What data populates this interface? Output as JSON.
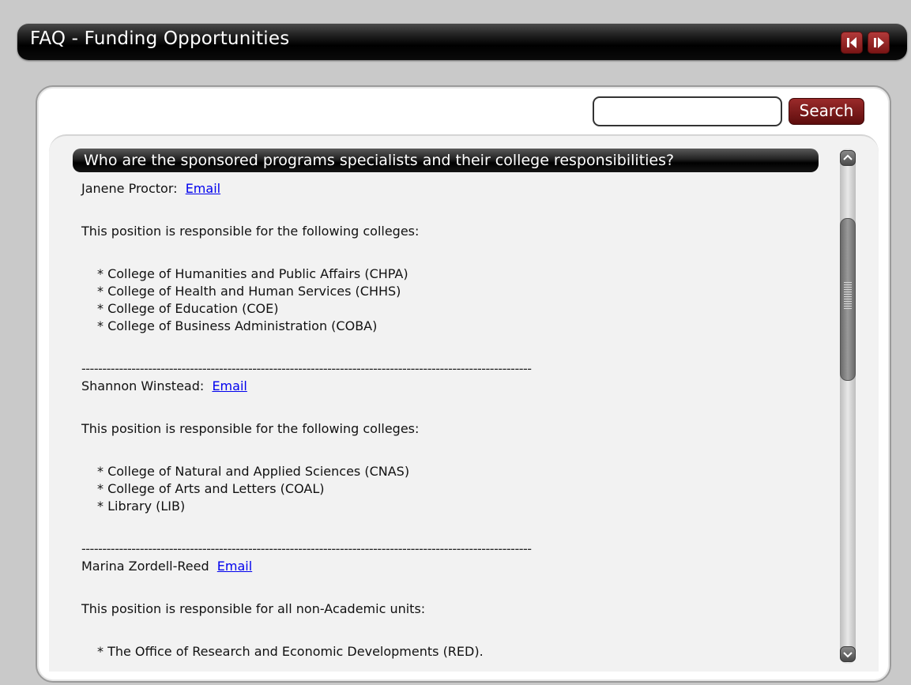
{
  "window": {
    "title": "FAQ - Funding Opportunities"
  },
  "search": {
    "value": "",
    "placeholder": "",
    "button_label": "Search"
  },
  "faq": {
    "question": "Who are the sponsored programs specialists and their college responsibilities?",
    "separator": "------------------------------------------------------------------------------------------------------------",
    "entries": [
      {
        "name": "Janene Proctor:",
        "link": "Email",
        "intro": "This position is responsible for the following colleges:",
        "items": [
          "* College of Humanities and Public Affairs (CHPA)",
          "* College of Health and Human Services (CHHS)",
          "* College of Education (COE)",
          "* College of Business Administration (COBA)"
        ]
      },
      {
        "name": "Shannon Winstead:",
        "link": "Email",
        "intro": "This position is responsible for the following colleges:",
        "items": [
          "* College of Natural and Applied Sciences (CNAS)",
          "* College of Arts and Letters (COAL)",
          "* Library (LIB)"
        ]
      },
      {
        "name": "Marina Zordell-Reed",
        "link": "Email",
        "intro": "This position is responsible for all non-Academic units:",
        "items": [
          "* The Office of Research and Economic Developments (RED)."
        ]
      }
    ]
  },
  "icons": {
    "prev": "previous-arrow-icon",
    "next": "next-arrow-icon",
    "scroll_up": "chevron-up-icon",
    "scroll_down": "chevron-down-icon"
  },
  "colors": {
    "accent": "#8b1e1e",
    "link": "#0000ee"
  }
}
